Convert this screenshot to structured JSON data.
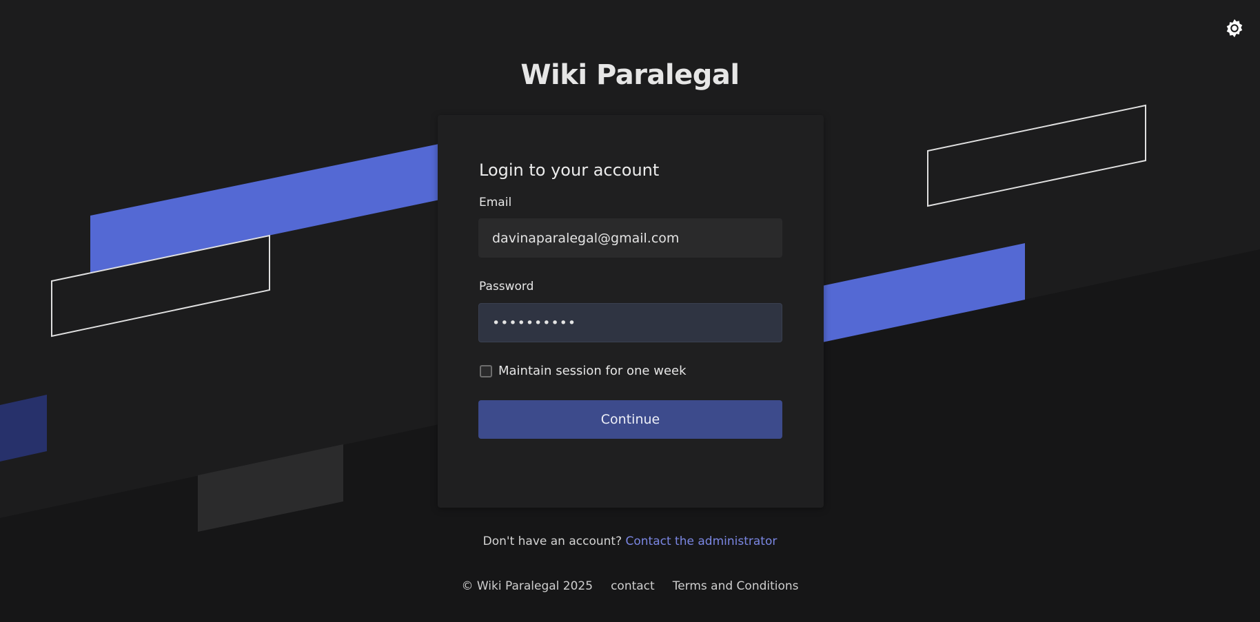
{
  "app": {
    "title": "Wiki Paralegal"
  },
  "theme_toggle": {
    "icon": "gear-icon"
  },
  "login": {
    "heading": "Login to your account",
    "email": {
      "label": "Email",
      "value": "davinaparalegal@gmail.com",
      "placeholder": ""
    },
    "password": {
      "label": "Password",
      "value": "••••••••••"
    },
    "remember": {
      "label": "Maintain session for one week",
      "checked": false
    },
    "submit_label": "Continue"
  },
  "signup": {
    "prompt": "Don't have an account?",
    "link_label": "Contact the administrator"
  },
  "footer": {
    "copyright": "© Wiki Paralegal 2025",
    "contact": "contact",
    "terms": "Terms and Conditions"
  },
  "colors": {
    "background": "#161617",
    "band": "#1c1c1d",
    "card": "#1f1f20",
    "accent": "#5469d4",
    "accent_dark": "#27316b",
    "button": "#3d4b8c",
    "link": "#7b87e3",
    "outline": "#e0e0e0"
  }
}
